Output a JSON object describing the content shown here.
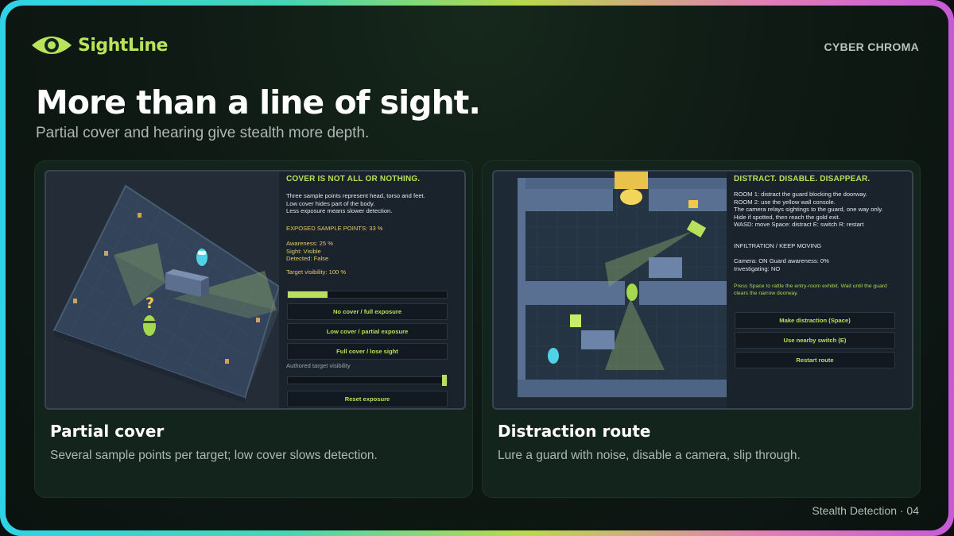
{
  "brand": {
    "name": "SightLine",
    "theme": "CYBER CHROMA",
    "accent": "#b8e35a"
  },
  "hero": {
    "title": "More than a line of sight.",
    "subtitle": "Partial cover and hearing give stealth more depth."
  },
  "cards": [
    {
      "title": "Partial cover",
      "description": "Several sample points per target; low cover slows detection.",
      "panel": {
        "heading": "COVER IS NOT ALL OR NOTHING.",
        "intro": "Three sample points represent head, torso and feet.\nLow cover hides part of the body.\nLess exposure means slower detection.",
        "exposed": "EXPOSED SAMPLE POINTS: 33 %",
        "stats": "Awareness: 25 %\nSight: Visible\nDetected: False",
        "visibility": "Target visibility: 100 %",
        "progress": 0.25,
        "buttons": [
          "No cover / full exposure",
          "Low cover / partial exposure",
          "Full cover / lose sight"
        ],
        "authored_label": "Authored target visibility",
        "authored_value": 1.0,
        "reset": "Reset exposure"
      },
      "scene": {
        "marker": "?"
      }
    },
    {
      "title": "Distraction route",
      "description": "Lure a guard with noise, disable a camera, slip through.",
      "panel": {
        "heading": "DISTRACT. DISABLE. DISAPPEAR.",
        "rooms": "ROOM 1: distract the guard blocking the doorway.\nROOM 2: use the yellow wall console.\nThe camera relays sightings to the guard, one way only.\nHide if spotted, then reach the gold exit.\nWASD: move   Space: distract   E: switch   R: restart",
        "mode": "INFILTRATION / KEEP MOVING",
        "status": "Camera: ON     Guard awareness: 0%\nInvestigating: NO",
        "hint": "Press Space to rattle the entry-room exhibit. Wait until the guard clears the narrow doorway.",
        "buttons": [
          "Make distraction (Space)",
          "Use nearby switch (E)",
          "Restart route"
        ]
      }
    }
  ],
  "footer": "Stealth Detection · 04"
}
